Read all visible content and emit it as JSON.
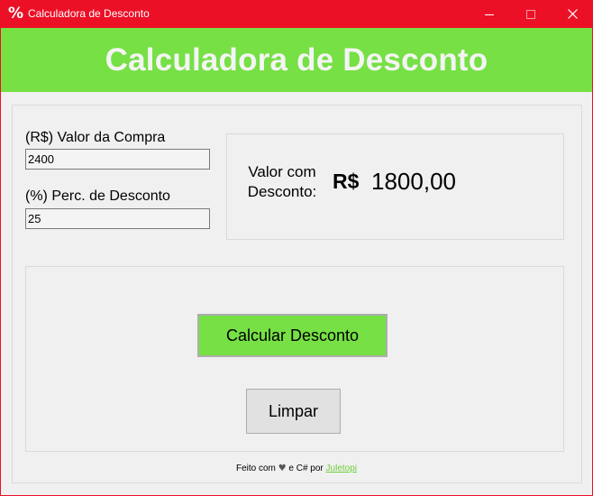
{
  "window": {
    "title": "Calculadora de Desconto",
    "app_icon": "percent-icon",
    "controls": [
      "minimize-icon",
      "maximize-icon",
      "close-icon"
    ],
    "accent_color": "#ec1026"
  },
  "header": {
    "title": "Calculadora de Desconto",
    "bg_color": "#76e045"
  },
  "form": {
    "purchase_label": "(R$) Valor da Compra",
    "purchase_value": "2400",
    "percent_label": "(%) Perc. de Desconto",
    "percent_value": "25"
  },
  "result": {
    "label_line1": "Valor com",
    "label_line2": "Desconto:",
    "currency": "R$",
    "amount": "1800,00"
  },
  "buttons": {
    "calculate_label": "Calcular Desconto",
    "clear_label": "Limpar"
  },
  "footer": {
    "prefix": "Feito com",
    "heart_icon": "heart-icon",
    "middle": "e C# por",
    "author_link": "Juletopi"
  }
}
